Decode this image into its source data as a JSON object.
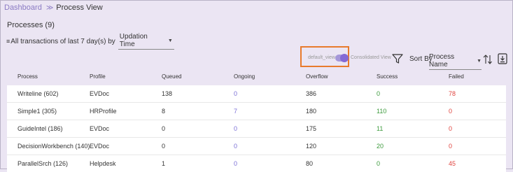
{
  "breadcrumb": {
    "parent": "Dashboard",
    "separator": "≫",
    "current": "Process View"
  },
  "header": {
    "title": "Processes (9)",
    "filter_prefix": "All transactions of last 7 day(s) by",
    "filter_value": "Updation Time"
  },
  "view_toggle": {
    "left_label": "default_view",
    "right_label": "Consolidated View",
    "on": true
  },
  "toolbar": {
    "sort_label": "Sort By",
    "sort_value": "Process Name"
  },
  "colors": {
    "accent": "#8469d6",
    "success": "#3c9a3c",
    "failed": "#e0443f",
    "highlight": "#e87a2c"
  },
  "icons": {
    "filter": "filter-funnel-icon",
    "sort": "sort-direction-icon",
    "download": "download-icon",
    "dropdown": "caret-down-icon"
  },
  "table": {
    "columns": [
      "Process",
      "Profile",
      "Queued",
      "Ongoing",
      "Overflow",
      "Success",
      "Failed"
    ],
    "rows": [
      [
        "Writeline (602)",
        "EVDoc",
        "138",
        "0",
        "386",
        "0",
        "78"
      ],
      [
        "Simple1 (305)",
        "HRProfile",
        "8",
        "7",
        "180",
        "110",
        "0"
      ],
      [
        "GuideIntel (186)",
        "EVDoc",
        "0",
        "0",
        "175",
        "11",
        "0"
      ],
      [
        "DecisionWorkbench (140)",
        "EVDoc",
        "0",
        "0",
        "120",
        "20",
        "0"
      ],
      [
        "ParallelSrch (126)",
        "Helpdesk",
        "1",
        "0",
        "80",
        "0",
        "45"
      ]
    ]
  }
}
